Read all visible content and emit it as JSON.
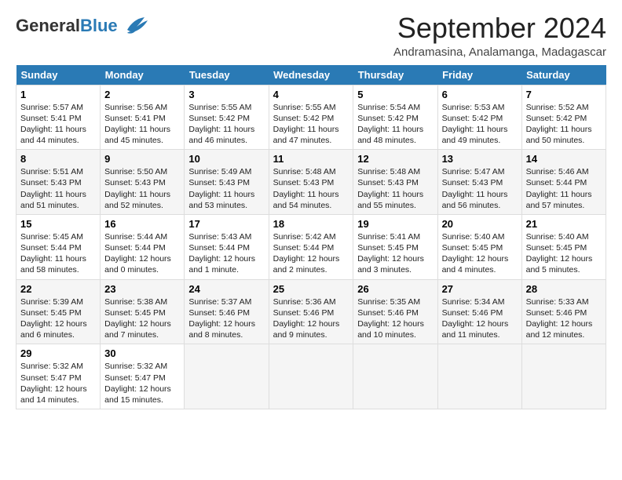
{
  "logo": {
    "general": "General",
    "blue": "Blue"
  },
  "header": {
    "month": "September 2024",
    "location": "Andramasina, Analamanga, Madagascar"
  },
  "weekdays": [
    "Sunday",
    "Monday",
    "Tuesday",
    "Wednesday",
    "Thursday",
    "Friday",
    "Saturday"
  ],
  "weeks": [
    [
      {
        "day": "1",
        "sunrise": "5:57 AM",
        "sunset": "5:41 PM",
        "daylight": "11 hours and 44 minutes."
      },
      {
        "day": "2",
        "sunrise": "5:56 AM",
        "sunset": "5:41 PM",
        "daylight": "11 hours and 45 minutes."
      },
      {
        "day": "3",
        "sunrise": "5:55 AM",
        "sunset": "5:42 PM",
        "daylight": "11 hours and 46 minutes."
      },
      {
        "day": "4",
        "sunrise": "5:55 AM",
        "sunset": "5:42 PM",
        "daylight": "11 hours and 47 minutes."
      },
      {
        "day": "5",
        "sunrise": "5:54 AM",
        "sunset": "5:42 PM",
        "daylight": "11 hours and 48 minutes."
      },
      {
        "day": "6",
        "sunrise": "5:53 AM",
        "sunset": "5:42 PM",
        "daylight": "11 hours and 49 minutes."
      },
      {
        "day": "7",
        "sunrise": "5:52 AM",
        "sunset": "5:42 PM",
        "daylight": "11 hours and 50 minutes."
      }
    ],
    [
      {
        "day": "8",
        "sunrise": "5:51 AM",
        "sunset": "5:43 PM",
        "daylight": "11 hours and 51 minutes."
      },
      {
        "day": "9",
        "sunrise": "5:50 AM",
        "sunset": "5:43 PM",
        "daylight": "11 hours and 52 minutes."
      },
      {
        "day": "10",
        "sunrise": "5:49 AM",
        "sunset": "5:43 PM",
        "daylight": "11 hours and 53 minutes."
      },
      {
        "day": "11",
        "sunrise": "5:48 AM",
        "sunset": "5:43 PM",
        "daylight": "11 hours and 54 minutes."
      },
      {
        "day": "12",
        "sunrise": "5:48 AM",
        "sunset": "5:43 PM",
        "daylight": "11 hours and 55 minutes."
      },
      {
        "day": "13",
        "sunrise": "5:47 AM",
        "sunset": "5:43 PM",
        "daylight": "11 hours and 56 minutes."
      },
      {
        "day": "14",
        "sunrise": "5:46 AM",
        "sunset": "5:44 PM",
        "daylight": "11 hours and 57 minutes."
      }
    ],
    [
      {
        "day": "15",
        "sunrise": "5:45 AM",
        "sunset": "5:44 PM",
        "daylight": "11 hours and 58 minutes."
      },
      {
        "day": "16",
        "sunrise": "5:44 AM",
        "sunset": "5:44 PM",
        "daylight": "12 hours and 0 minutes."
      },
      {
        "day": "17",
        "sunrise": "5:43 AM",
        "sunset": "5:44 PM",
        "daylight": "12 hours and 1 minute."
      },
      {
        "day": "18",
        "sunrise": "5:42 AM",
        "sunset": "5:44 PM",
        "daylight": "12 hours and 2 minutes."
      },
      {
        "day": "19",
        "sunrise": "5:41 AM",
        "sunset": "5:45 PM",
        "daylight": "12 hours and 3 minutes."
      },
      {
        "day": "20",
        "sunrise": "5:40 AM",
        "sunset": "5:45 PM",
        "daylight": "12 hours and 4 minutes."
      },
      {
        "day": "21",
        "sunrise": "5:40 AM",
        "sunset": "5:45 PM",
        "daylight": "12 hours and 5 minutes."
      }
    ],
    [
      {
        "day": "22",
        "sunrise": "5:39 AM",
        "sunset": "5:45 PM",
        "daylight": "12 hours and 6 minutes."
      },
      {
        "day": "23",
        "sunrise": "5:38 AM",
        "sunset": "5:45 PM",
        "daylight": "12 hours and 7 minutes."
      },
      {
        "day": "24",
        "sunrise": "5:37 AM",
        "sunset": "5:46 PM",
        "daylight": "12 hours and 8 minutes."
      },
      {
        "day": "25",
        "sunrise": "5:36 AM",
        "sunset": "5:46 PM",
        "daylight": "12 hours and 9 minutes."
      },
      {
        "day": "26",
        "sunrise": "5:35 AM",
        "sunset": "5:46 PM",
        "daylight": "12 hours and 10 minutes."
      },
      {
        "day": "27",
        "sunrise": "5:34 AM",
        "sunset": "5:46 PM",
        "daylight": "12 hours and 11 minutes."
      },
      {
        "day": "28",
        "sunrise": "5:33 AM",
        "sunset": "5:46 PM",
        "daylight": "12 hours and 12 minutes."
      }
    ],
    [
      {
        "day": "29",
        "sunrise": "5:32 AM",
        "sunset": "5:47 PM",
        "daylight": "12 hours and 14 minutes."
      },
      {
        "day": "30",
        "sunrise": "5:32 AM",
        "sunset": "5:47 PM",
        "daylight": "12 hours and 15 minutes."
      },
      null,
      null,
      null,
      null,
      null
    ]
  ]
}
